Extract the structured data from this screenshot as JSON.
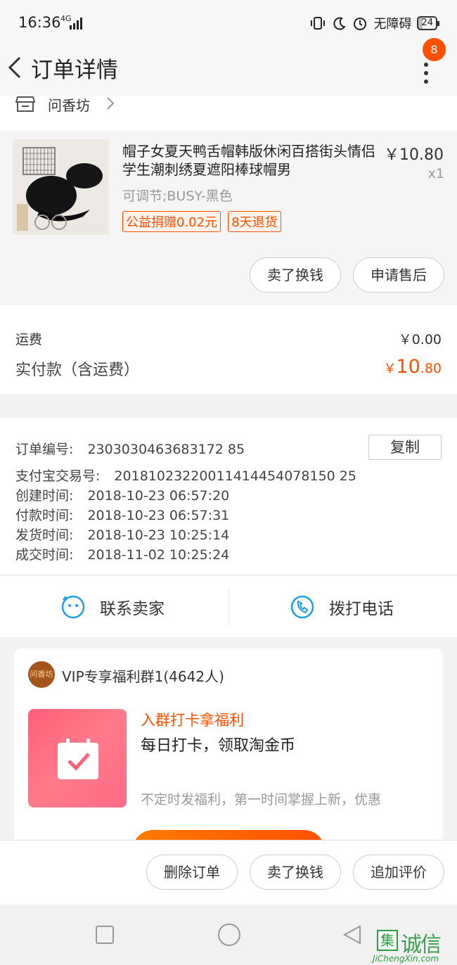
{
  "status_bar": {
    "time": "16:36",
    "network": "4G",
    "accessibility": "无障碍",
    "battery": "24"
  },
  "nav": {
    "title": "订单详情",
    "badge_count": "8"
  },
  "shop": {
    "name": "问香坊"
  },
  "product": {
    "title": "帽子女夏天鸭舌帽韩版休闲百搭街头情侣学生潮刺绣夏遮阳棒球帽男",
    "price": "￥10.80",
    "quantity": "x1",
    "spec": "可调节;BUSY-黑色",
    "tags": [
      "公益捐赠0.02元",
      "8天退货"
    ],
    "buttons": {
      "sell": "卖了换钱",
      "after_sale": "申请售后"
    }
  },
  "fees": {
    "shipping_label": "运费",
    "shipping_value": "￥0.00",
    "paid_label": "实付款（含运费）",
    "paid_currency": "￥",
    "paid_integer": "10",
    "paid_decimal": ".80"
  },
  "order_info": {
    "order_no_label": "订单编号:",
    "order_no": "2303030463683172 85",
    "alipay_label": "支付宝交易号:",
    "alipay_no": "20181023220011414454078150 25",
    "created_label": "创建时间:",
    "created": "2018-10-23 06:57:20",
    "paid_time_label": "付款时间:",
    "paid_time": "2018-10-23 06:57:31",
    "shipped_label": "发货时间:",
    "shipped": "2018-10-23 10:25:14",
    "completed_label": "成交时间:",
    "completed": "2018-11-02 10:25:24",
    "copy_label": "复制"
  },
  "contact": {
    "seller": "联系卖家",
    "call": "拨打电话"
  },
  "group": {
    "name": "VIP专享福利群1(4642人)",
    "tagline": "入群打卡拿福利",
    "headline": "每日打卡，领取淘金币",
    "desc": "不定时发福利，第一时间掌握上新，优惠"
  },
  "bottom_actions": {
    "delete": "删除订单",
    "sell": "卖了换钱",
    "review": "追加评价"
  },
  "watermark": {
    "text": "诚信",
    "url": "JiChengXin.com"
  },
  "colors": {
    "accent": "#ff5000"
  }
}
